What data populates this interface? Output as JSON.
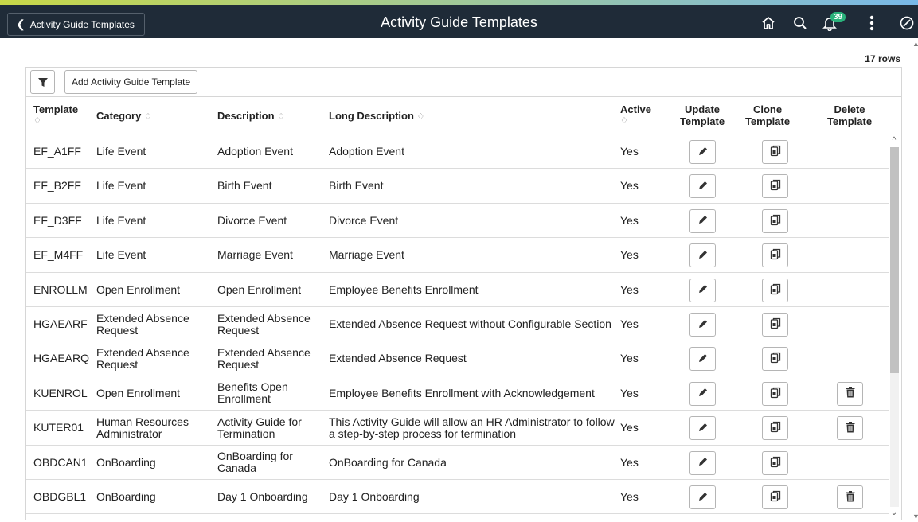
{
  "header": {
    "back_label": "Activity Guide Templates",
    "title": "Activity Guide Templates",
    "notification_count": "39"
  },
  "grid": {
    "row_count": "17 rows",
    "add_button": "Add Activity Guide Template",
    "columns": {
      "template": "Template",
      "category": "Category",
      "description": "Description",
      "long_description": "Long Description",
      "active": "Active",
      "update": "Update Template",
      "clone": "Clone Template",
      "delete": "Delete Template"
    },
    "sort_glyph": "♢",
    "rows": [
      {
        "template": "EF_A1FF",
        "category": "Life Event",
        "description": "Adoption Event",
        "long_description": "Adoption Event",
        "active": "Yes",
        "deletable": false
      },
      {
        "template": "EF_B2FF",
        "category": "Life Event",
        "description": "Birth Event",
        "long_description": "Birth Event",
        "active": "Yes",
        "deletable": false
      },
      {
        "template": "EF_D3FF",
        "category": "Life Event",
        "description": "Divorce Event",
        "long_description": "Divorce Event",
        "active": "Yes",
        "deletable": false
      },
      {
        "template": "EF_M4FF",
        "category": "Life Event",
        "description": "Marriage Event",
        "long_description": "Marriage Event",
        "active": "Yes",
        "deletable": false
      },
      {
        "template": "ENROLLM",
        "category": "Open Enrollment",
        "description": "Open Enrollment",
        "long_description": "Employee Benefits Enrollment",
        "active": "Yes",
        "deletable": false
      },
      {
        "template": "HGAEARF",
        "category": "Extended Absence Request",
        "description": "Extended Absence Request",
        "long_description": "Extended Absence Request without Configurable Section",
        "active": "Yes",
        "deletable": false
      },
      {
        "template": "HGAEARQ",
        "category": "Extended Absence Request",
        "description": "Extended Absence Request",
        "long_description": "Extended Absence Request",
        "active": "Yes",
        "deletable": false
      },
      {
        "template": "KUENROL",
        "category": "Open Enrollment",
        "description": "Benefits Open Enrollment",
        "long_description": "Employee Benefits Enrollment with Acknowledgement",
        "active": "Yes",
        "deletable": true
      },
      {
        "template": "KUTER01",
        "category": "Human Resources Administrator",
        "description": "Activity Guide for Termination",
        "long_description": "This Activity Guide will allow an HR Administrator to follow a step-by-step process for termination",
        "active": "Yes",
        "deletable": true
      },
      {
        "template": "OBDCAN1",
        "category": "OnBoarding",
        "description": "OnBoarding for Canada",
        "long_description": "OnBoarding for Canada",
        "active": "Yes",
        "deletable": false
      },
      {
        "template": "OBDGBL1",
        "category": "OnBoarding",
        "description": "Day 1 Onboarding",
        "long_description": "Day 1 Onboarding",
        "active": "Yes",
        "deletable": true
      }
    ]
  }
}
